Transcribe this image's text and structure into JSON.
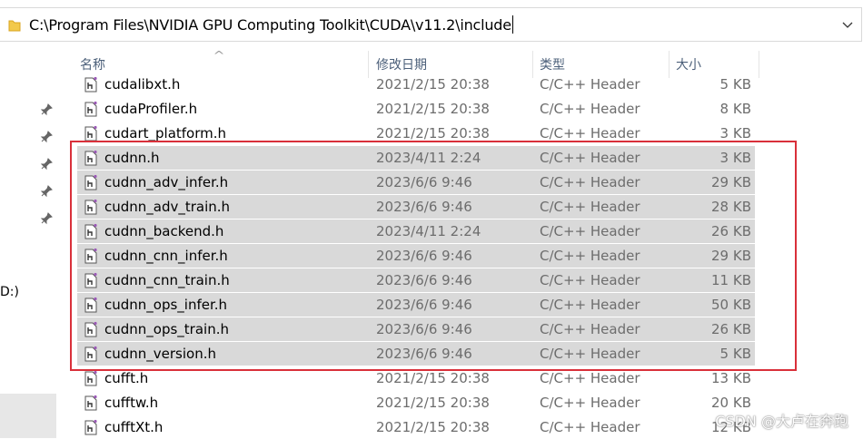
{
  "address": {
    "path": "C:\\Program Files\\NVIDIA GPU Computing Toolkit\\CUDA\\v11.2\\include"
  },
  "nav": {
    "drive_label": "D:)"
  },
  "headers": {
    "name": "名称",
    "date": "修改日期",
    "type": "类型",
    "size": "大小"
  },
  "files": [
    {
      "name": "cudalibxt.h",
      "date": "2021/2/15 20:38",
      "type": "C/C++ Header",
      "size": "5 KB",
      "selected": false
    },
    {
      "name": "cudaProfiler.h",
      "date": "2021/2/15 20:38",
      "type": "C/C++ Header",
      "size": "8 KB",
      "selected": false
    },
    {
      "name": "cudart_platform.h",
      "date": "2021/2/15 20:38",
      "type": "C/C++ Header",
      "size": "3 KB",
      "selected": false
    },
    {
      "name": "cudnn.h",
      "date": "2023/4/11 2:24",
      "type": "C/C++ Header",
      "size": "3 KB",
      "selected": true
    },
    {
      "name": "cudnn_adv_infer.h",
      "date": "2023/6/6 9:46",
      "type": "C/C++ Header",
      "size": "29 KB",
      "selected": true
    },
    {
      "name": "cudnn_adv_train.h",
      "date": "2023/6/6 9:46",
      "type": "C/C++ Header",
      "size": "28 KB",
      "selected": true
    },
    {
      "name": "cudnn_backend.h",
      "date": "2023/4/11 2:24",
      "type": "C/C++ Header",
      "size": "26 KB",
      "selected": true
    },
    {
      "name": "cudnn_cnn_infer.h",
      "date": "2023/6/6 9:46",
      "type": "C/C++ Header",
      "size": "29 KB",
      "selected": true
    },
    {
      "name": "cudnn_cnn_train.h",
      "date": "2023/6/6 9:46",
      "type": "C/C++ Header",
      "size": "11 KB",
      "selected": true
    },
    {
      "name": "cudnn_ops_infer.h",
      "date": "2023/6/6 9:46",
      "type": "C/C++ Header",
      "size": "50 KB",
      "selected": true
    },
    {
      "name": "cudnn_ops_train.h",
      "date": "2023/6/6 9:46",
      "type": "C/C++ Header",
      "size": "26 KB",
      "selected": true
    },
    {
      "name": "cudnn_version.h",
      "date": "2023/6/6 9:46",
      "type": "C/C++ Header",
      "size": "5 KB",
      "selected": true
    },
    {
      "name": "cufft.h",
      "date": "2021/2/15 20:38",
      "type": "C/C++ Header",
      "size": "13 KB",
      "selected": false
    },
    {
      "name": "cufftw.h",
      "date": "2021/2/15 20:38",
      "type": "C/C++ Header",
      "size": "20 KB",
      "selected": false
    },
    {
      "name": "cufftXt.h",
      "date": "2021/2/15 20:38",
      "type": "C/C++ Header",
      "size": "12 KB",
      "selected": false
    }
  ],
  "watermark": "CSDN @大卢在奔跑",
  "colors": {
    "selection": "#d9d9d9",
    "highlight_box": "#d9303a",
    "header_text": "#4c607a"
  }
}
